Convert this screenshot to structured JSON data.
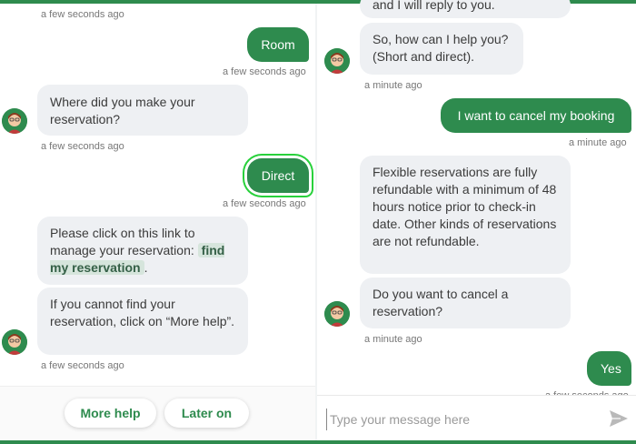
{
  "left_panel": {
    "messages": [
      {
        "type": "timestamp",
        "text": "a few seconds ago"
      },
      {
        "type": "user",
        "text": "Room"
      },
      {
        "type": "timestamp",
        "text": "a few seconds ago"
      },
      {
        "type": "bot",
        "text": "Where did you make your reservation?"
      },
      {
        "type": "timestamp",
        "text": "a few seconds ago"
      },
      {
        "type": "user",
        "text": "Direct"
      },
      {
        "type": "timestamp",
        "text": "a few seconds ago"
      },
      {
        "type": "bot",
        "text_before": "Please click on this link to manage your reservation:",
        "link": "find my reservation",
        "text_after": "."
      },
      {
        "type": "bot",
        "text": "If you cannot find your reservation, click on “More help”."
      },
      {
        "type": "timestamp",
        "text": "a few seconds ago"
      }
    ],
    "quick_replies": [
      "More help",
      "Later on"
    ]
  },
  "right_panel": {
    "messages": [
      {
        "type": "bot",
        "text": "and I will reply to you."
      },
      {
        "type": "bot",
        "text": "So, how can I help you? (Short and direct)."
      },
      {
        "type": "timestamp",
        "text": "a minute ago"
      },
      {
        "type": "user",
        "text": "I want to cancel my booking"
      },
      {
        "type": "timestamp",
        "text": "a minute ago"
      },
      {
        "type": "bot",
        "text": "Flexible reservations are fully refundable with a minimum of 48 hours notice prior to check-in date. Other kinds of reservations are not refundable."
      },
      {
        "type": "bot",
        "text": "Do you want to cancel a reservation?"
      },
      {
        "type": "timestamp",
        "text": "a minute ago"
      },
      {
        "type": "user",
        "text": "Yes"
      },
      {
        "type": "timestamp",
        "text": "a few seconds ago"
      }
    ],
    "input": {
      "placeholder": "Type your message here",
      "value": ""
    }
  },
  "colors": {
    "accent": "#2e8b4e",
    "bot_bubble": "#eef0f3",
    "highlight": "#28d13b"
  },
  "icons": {
    "send": "send-arrow-icon",
    "avatar": "bot-avatar-icon"
  }
}
